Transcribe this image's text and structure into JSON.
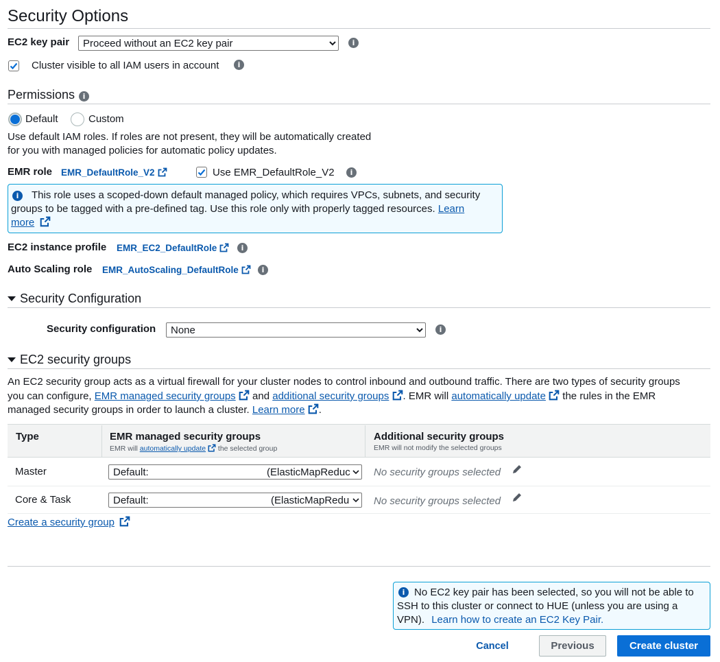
{
  "security_options": {
    "title": "Security Options",
    "key_pair_label": "EC2 key pair",
    "key_pair_value": "Proceed without an EC2 key pair",
    "cluster_visible_label": "Cluster visible to all IAM users in account"
  },
  "permissions": {
    "title": "Permissions",
    "default_label": "Default",
    "custom_label": "Custom",
    "description_line1": "Use default IAM roles. If roles are not present, they will be automatically created",
    "description_line2": "for you with managed policies for automatic policy updates.",
    "emr_role_label": "EMR role",
    "emr_role_link": "EMR_DefaultRole_V2",
    "use_v2_label": "Use EMR_DefaultRole_V2",
    "infobox_line1": "This role uses a scoped-down default managed policy, which requires VPCs, subnets, and security",
    "infobox_line2": "groups to be tagged with a pre-defined tag. Use this role only with properly tagged resources.",
    "infobox_learn": "Learn",
    "infobox_more": "more",
    "instance_profile_label": "EC2 instance profile",
    "instance_profile_link": "EMR_EC2_DefaultRole",
    "autoscaling_label": "Auto Scaling role",
    "autoscaling_link": "EMR_AutoScaling_DefaultRole"
  },
  "security_configuration": {
    "title": "Security Configuration",
    "label": "Security configuration",
    "value": "None"
  },
  "ec2_groups": {
    "title": "EC2 security groups",
    "desc_line1": "An EC2 security group acts as a virtual firewall for your cluster nodes to control inbound and outbound traffic. There are two types of security groups",
    "desc_line2_a": "you can configure,",
    "desc_link1": "EMR managed security groups",
    "desc_line2_b": "and",
    "desc_link2": "additional security groups",
    "desc_line2_c": ". EMR will",
    "desc_link3": "automatically update",
    "desc_line2_d": "the rules in the EMR",
    "desc_line3": "managed security groups in order to launch a cluster.",
    "desc_link4": "Learn more",
    "table": {
      "col_type": "Type",
      "col_emr": "EMR managed security groups",
      "col_emr_sub_a": "EMR will",
      "col_emr_sub_link": "automatically update",
      "col_emr_sub_b": "the selected group",
      "col_add": "Additional security groups",
      "col_add_sub": "EMR will not modify the selected groups",
      "rows": [
        {
          "type": "Master",
          "emr_left": "Default:",
          "emr_right": "(ElasticMapReduc",
          "additional": "No security groups selected"
        },
        {
          "type": "Core & Task",
          "emr_left": "Default:",
          "emr_right": "(ElasticMapRedu",
          "additional": "No security groups selected"
        }
      ]
    },
    "create_link": "Create a security group"
  },
  "footer": {
    "note_line1": "No EC2 key pair has been selected, so you will not be able to",
    "note_line2": "SSH to this cluster or connect to HUE (unless you are using a",
    "note_line3_a": "VPN).",
    "note_link": "Learn how to create an EC2 Key Pair.",
    "cancel": "Cancel",
    "previous": "Previous",
    "create": "Create cluster"
  },
  "colors": {
    "link": "#0a59ad",
    "primary_button": "#0a6fd6",
    "info_border": "#0a9fd6",
    "info_bg": "#f1faff"
  }
}
